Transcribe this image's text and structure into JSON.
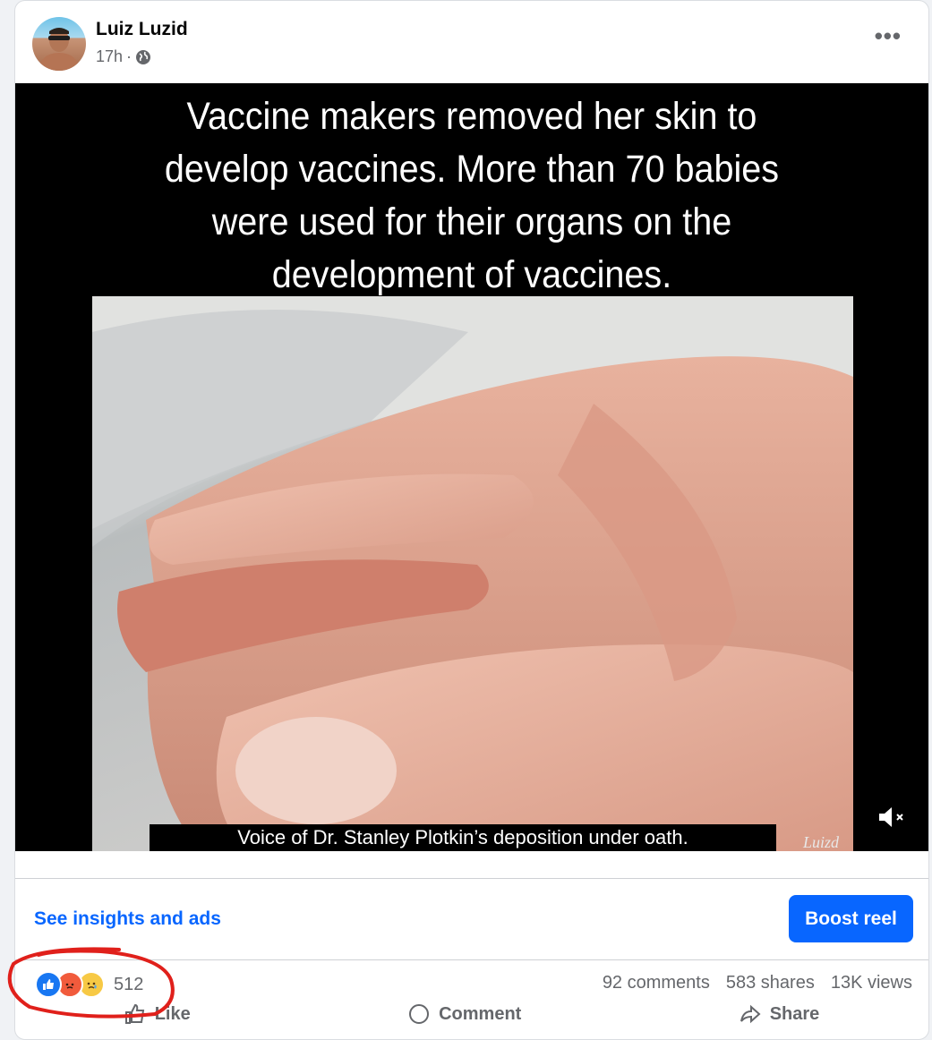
{
  "post": {
    "author": "Luiz Luzid",
    "time": "17h",
    "separator": "·",
    "privacy_icon": "globe-icon",
    "more_icon": "more-options-icon",
    "more_label": "•••"
  },
  "video": {
    "caption": "Vaccine makers removed her skin to develop vaccines. More than 70 babies were used for their organs on the development of vaccines.",
    "caption_lines": [
      "Vaccine makers removed her skin to",
      "develop vaccines. More than 70 babies",
      "were used for their organs on the",
      "development of vaccines."
    ],
    "subtitle": "Voice of Dr. Stanley Plotkin’s deposition under oath.",
    "watermark": "Luizd",
    "mute_icon": "muted-speaker-icon"
  },
  "insights": {
    "link": "See insights and ads",
    "boost_button": "Boost reel"
  },
  "engagement": {
    "reaction_icons": [
      "like-icon",
      "angry-icon",
      "sad-icon"
    ],
    "reaction_count": "512",
    "comments": "92 comments",
    "shares": "583 shares",
    "views": "13K views"
  },
  "actions": {
    "like": "Like",
    "comment": "Comment",
    "share": "Share"
  },
  "colors": {
    "accent": "#0866ff",
    "secondary_text": "#65676b",
    "annotation": "#e0201b"
  }
}
